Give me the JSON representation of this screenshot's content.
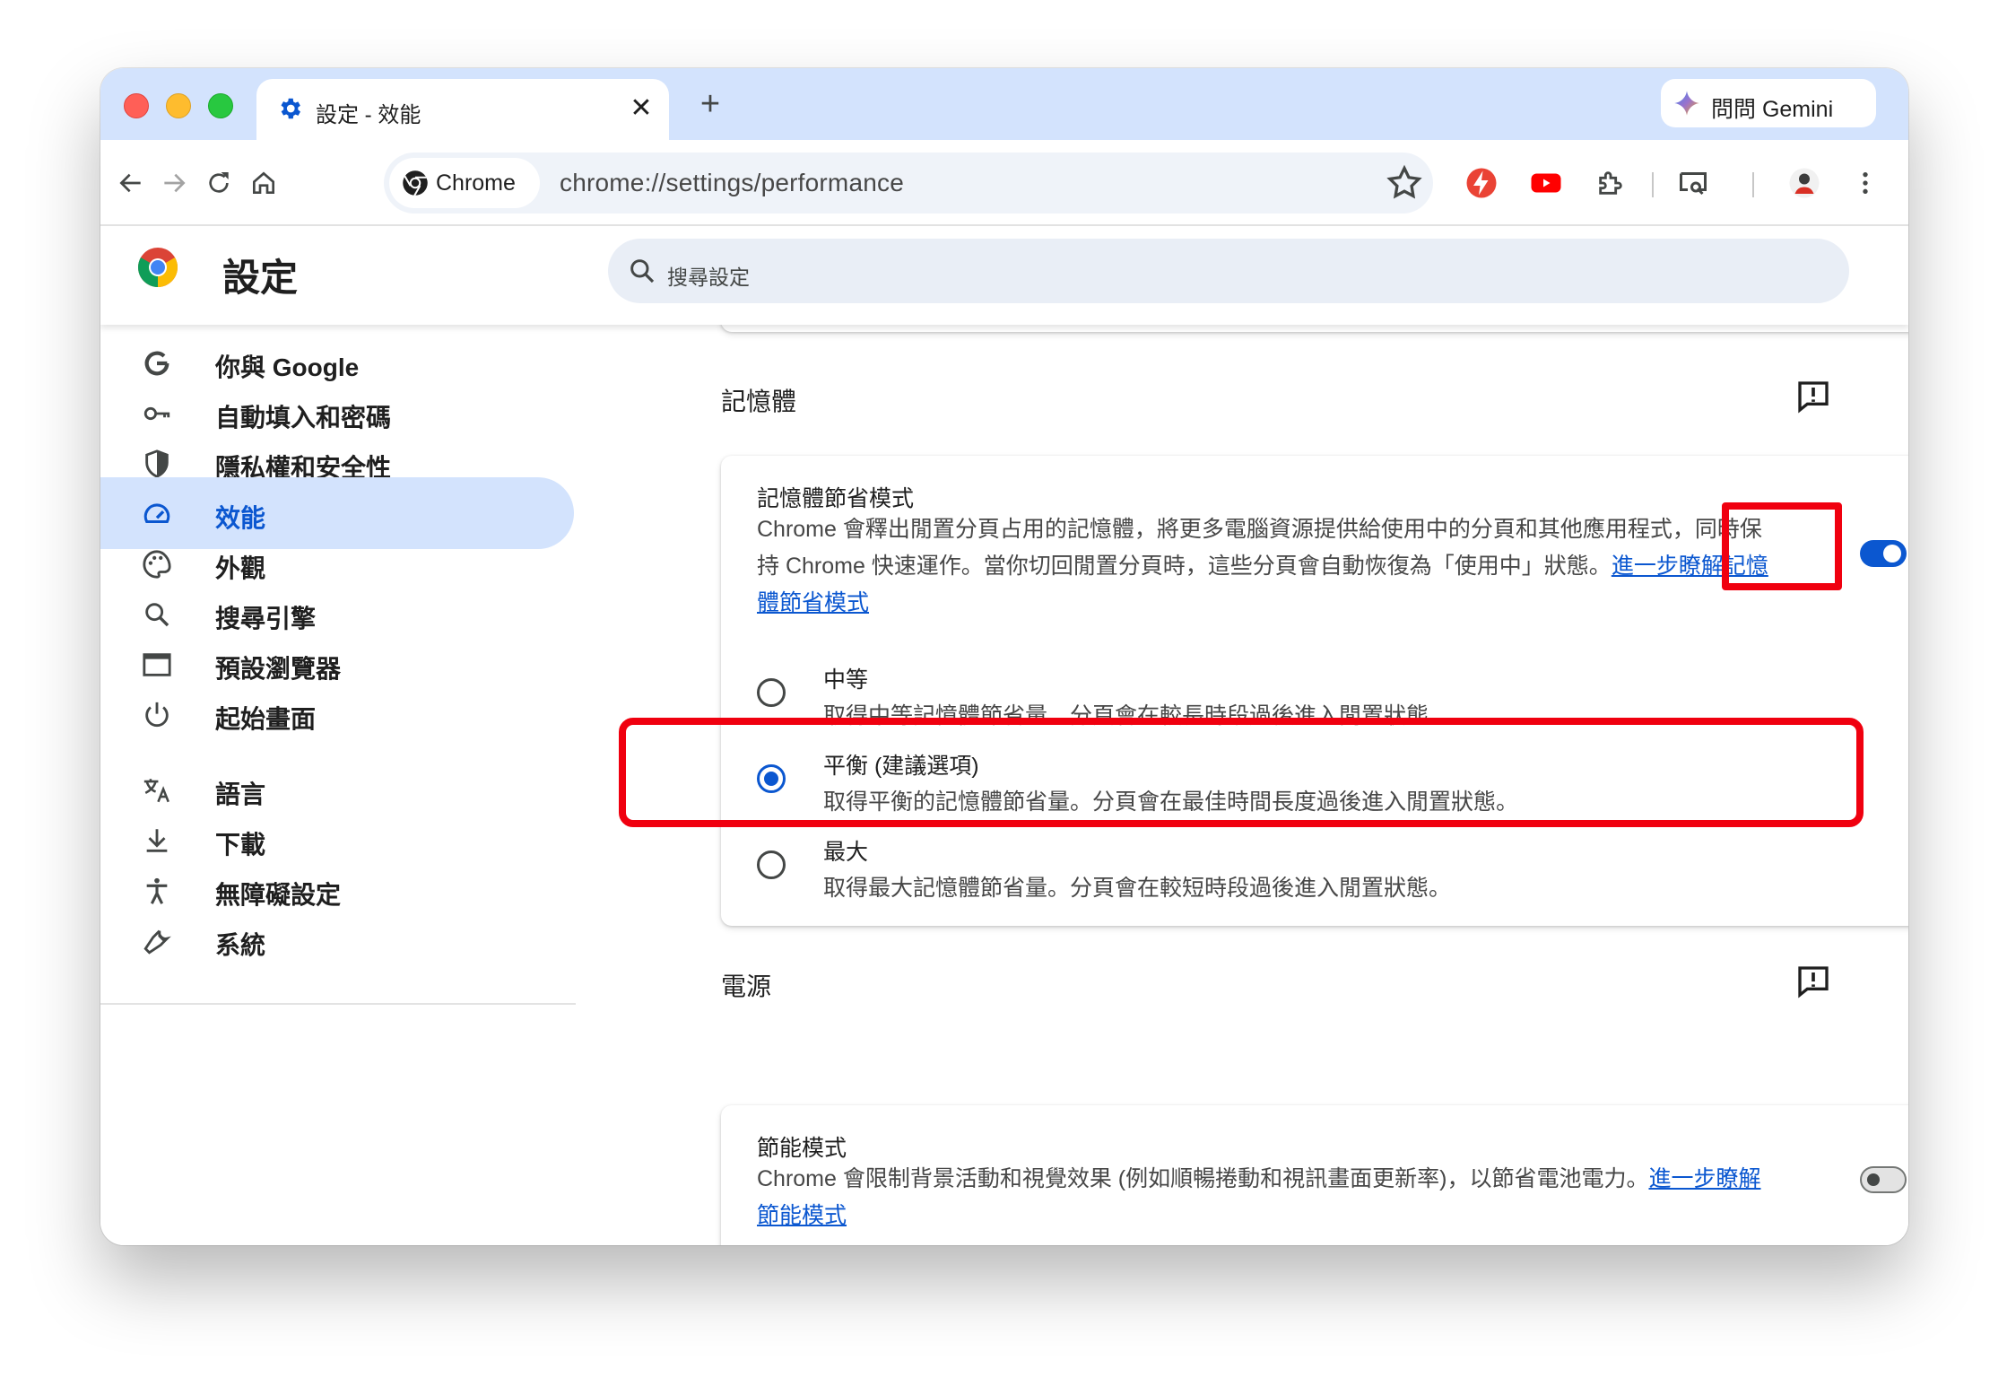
{
  "tab": {
    "title": "設定 - 效能",
    "close": "✕"
  },
  "newtab": "+",
  "gemini": {
    "label": "問問 Gemini"
  },
  "omnibox": {
    "chip": "Chrome",
    "url": "chrome://settings/performance"
  },
  "header": {
    "title": "設定",
    "search_placeholder": "搜尋設定"
  },
  "sidebar": {
    "items": [
      {
        "label": "你與 Google",
        "icon": "google-g-icon"
      },
      {
        "label": "自動填入和密碼",
        "icon": "key-icon"
      },
      {
        "label": "隱私權和安全性",
        "icon": "shield-icon"
      },
      {
        "label": "效能",
        "icon": "speedometer-icon",
        "active": true
      },
      {
        "label": "外觀",
        "icon": "palette-icon"
      },
      {
        "label": "搜尋引擎",
        "icon": "search-icon"
      },
      {
        "label": "預設瀏覽器",
        "icon": "browser-window-icon"
      },
      {
        "label": "起始畫面",
        "icon": "power-icon"
      },
      {
        "label": "語言",
        "icon": "translate-icon"
      },
      {
        "label": "下載",
        "icon": "download-icon"
      },
      {
        "label": "無障礙設定",
        "icon": "accessibility-icon"
      },
      {
        "label": "系統",
        "icon": "wrench-icon"
      }
    ]
  },
  "memory": {
    "section_title": "記憶體",
    "saver_title": "記憶體節省模式",
    "saver_desc_line1": "Chrome 會釋出閒置分頁占用的記憶體，將更多電腦資源提供給使用中的分頁和其他應用程式，同時保",
    "saver_desc_line2": "持 Chrome 快速運作。當你切回閒置分頁時，這些分頁會自動恢復為「使用中」狀態。",
    "saver_link_part1": "進一步瞭解記憶",
    "saver_link_part2": "體節省模式",
    "enabled": true,
    "options": [
      {
        "title": "中等",
        "desc": "取得中等記憶體節省量。分頁會在較長時段過後進入閒置狀態。",
        "checked": false
      },
      {
        "title": "平衡 (建議選項)",
        "desc": "取得平衡的記憶體節省量。分頁會在最佳時間長度過後進入閒置狀態。",
        "checked": true
      },
      {
        "title": "最大",
        "desc": "取得最大記憶體節省量。分頁會在較短時段過後進入閒置狀態。",
        "checked": false
      }
    ]
  },
  "power": {
    "section_title": "電源",
    "saver_title": "節能模式",
    "saver_desc": "Chrome 會限制背景活動和視覺效果 (例如順暢捲動和視訊畫面更新率)，以節省電池電力。",
    "saver_link_part1": "進一步瞭解",
    "saver_link_part2": "節能模式",
    "enabled": false
  },
  "colors": {
    "accent": "#0b57d0",
    "tabstrip": "#d3e3fd",
    "highlight": "#f0000f"
  }
}
